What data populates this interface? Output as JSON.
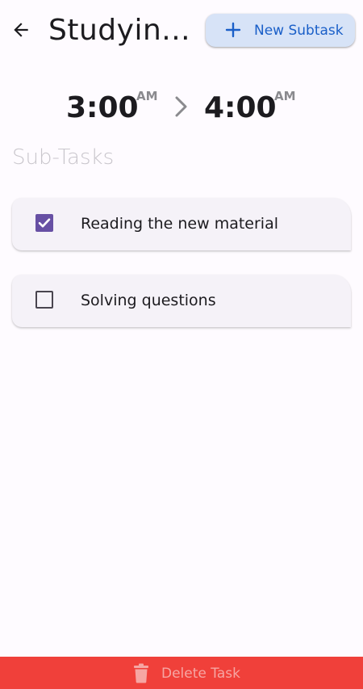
{
  "header": {
    "back_icon": "arrow-left-icon",
    "title": "Studyin...",
    "new_subtask_label": "New Subtask",
    "new_subtask_icon": "plus-icon"
  },
  "schedule": {
    "start_time": "3:00",
    "start_period": "AM",
    "separator_icon": "chevron-right-icon",
    "end_time": "4:00",
    "end_period": "AM"
  },
  "subtasks": {
    "heading": "Sub-Tasks",
    "items": [
      {
        "label": "Reading the new material",
        "checked": true
      },
      {
        "label": "Solving questions",
        "checked": false
      }
    ]
  },
  "footer": {
    "delete_label": "Delete Task",
    "delete_icon": "trash-icon"
  },
  "colors": {
    "background": "#fefbff",
    "accent": "#6750a4",
    "button_bg": "#d7e3f7",
    "button_text": "#1a5fc8",
    "danger": "#f0403a"
  }
}
